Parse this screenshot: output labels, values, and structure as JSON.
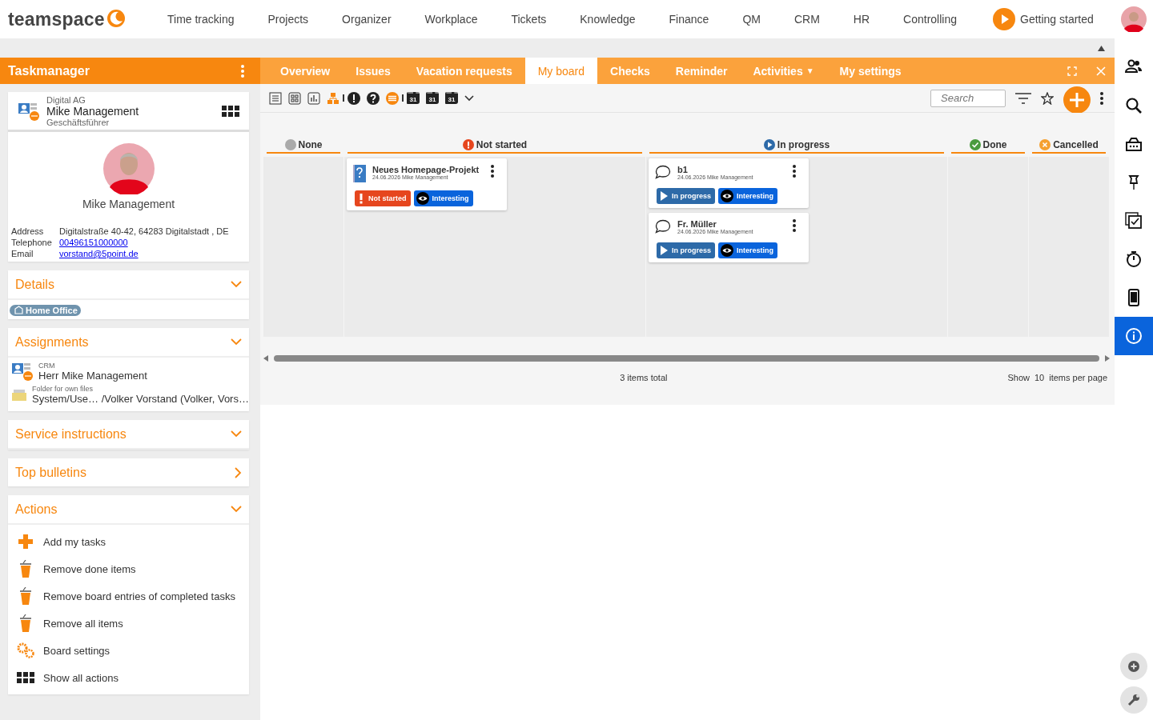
{
  "logo": {
    "text": "teamspace"
  },
  "nav": [
    "Time tracking",
    "Projects",
    "Organizer",
    "Workplace",
    "Tickets",
    "Knowledge",
    "Finance",
    "QM",
    "CRM",
    "HR",
    "Controlling"
  ],
  "getting_started": "Getting started",
  "left_panel": {
    "title": "Taskmanager",
    "contact": {
      "company": "Digital AG",
      "name": "Mike Management",
      "role": "Geschäftsführer",
      "display_name": "Mike Management",
      "fields": [
        {
          "label": "Address",
          "value": "Digitalstraße 40-42, 64283 Digitalstadt , DE",
          "kind": "text"
        },
        {
          "label": "Telephone",
          "value": "00496151000000",
          "kind": "link"
        },
        {
          "label": "Email",
          "value": "vorstand@5point.de",
          "kind": "link"
        }
      ]
    },
    "sections": [
      {
        "title": "Details",
        "expanded": true,
        "tags": [
          "Home Office"
        ]
      },
      {
        "title": "Assignments",
        "expanded": true,
        "items": [
          {
            "kind": "contact",
            "caption": "CRM",
            "value": "Herr Mike Management"
          },
          {
            "kind": "folder",
            "caption": "Folder for own files",
            "value": "System/Use… /Volker Vorstand (Volker, Vors…"
          }
        ]
      },
      {
        "title": "Service instructions",
        "expanded": true
      },
      {
        "title": "Top bulletins",
        "expanded": false
      },
      {
        "title": "Actions",
        "expanded": true,
        "actions": [
          {
            "kind": "add",
            "label": "Add my tasks"
          },
          {
            "kind": "trash",
            "label": "Remove done items"
          },
          {
            "kind": "trash",
            "label": "Remove board entries of completed tasks"
          },
          {
            "kind": "trash",
            "label": "Remove all items"
          },
          {
            "kind": "gears",
            "label": "Board settings"
          },
          {
            "kind": "grid",
            "label": "Show all actions"
          }
        ]
      }
    ]
  },
  "tabs": [
    {
      "label": "Overview",
      "selected": false
    },
    {
      "label": "Issues",
      "selected": false
    },
    {
      "label": "Vacation requests",
      "selected": false
    },
    {
      "label": "My board",
      "selected": true
    },
    {
      "label": "Checks",
      "selected": false
    },
    {
      "label": "Reminder",
      "selected": false
    },
    {
      "label": "Activities",
      "caret": "▼",
      "selected": false
    },
    {
      "label": "My settings",
      "selected": false
    }
  ],
  "toolbar": [
    {
      "kind": "list"
    },
    {
      "kind": "tiles"
    },
    {
      "kind": "chart"
    },
    {
      "kind": "hierarchy"
    },
    {
      "kind": "sep"
    },
    {
      "kind": "alert"
    },
    {
      "kind": "help"
    },
    {
      "kind": "lines"
    },
    {
      "kind": "sep"
    },
    {
      "kind": "calendar",
      "label": "31"
    },
    {
      "kind": "calendar",
      "label": "31"
    },
    {
      "kind": "calendar",
      "label": "31"
    },
    {
      "kind": "chevron"
    }
  ],
  "search": {
    "placeholder": "Search"
  },
  "board": {
    "columns": [
      {
        "name": "None",
        "kind": "none"
      },
      {
        "name": "Not started",
        "kind": "not_started",
        "cards": [
          {
            "kind": "question",
            "title": "Neues Homepage-Projekt",
            "meta": "24.06.2026 Mike Management",
            "tags": [
              {
                "kind": "not_started",
                "label": "Not started"
              },
              {
                "kind": "interesting",
                "label": "Interesting"
              }
            ]
          }
        ]
      },
      {
        "name": "In progress",
        "kind": "in_progress",
        "cards": [
          {
            "kind": "comment",
            "title": "b1",
            "meta": "24.06.2026 Mike Management",
            "tags": [
              {
                "kind": "in_progress",
                "label": "In progress"
              },
              {
                "kind": "interesting",
                "label": "Interesting"
              }
            ]
          },
          {
            "kind": "comment",
            "title": "Fr. Müller",
            "meta": "24.06.2026 Mike Management",
            "tags": [
              {
                "kind": "in_progress",
                "label": "In progress"
              },
              {
                "kind": "interesting",
                "label": "Interesting"
              }
            ]
          }
        ]
      },
      {
        "name": "Done",
        "kind": "done"
      },
      {
        "name": "Cancelled",
        "kind": "cancelled"
      }
    ],
    "total": "3 items total",
    "show": "Show",
    "per_page": "10",
    "per_page_suffix": "items per page"
  },
  "rail": [
    {
      "kind": "people",
      "selected": false
    },
    {
      "kind": "search",
      "selected": false
    },
    {
      "kind": "inbox",
      "selected": false
    },
    {
      "kind": "pin",
      "selected": false
    },
    {
      "kind": "checklist",
      "selected": false
    },
    {
      "kind": "stopwatch",
      "selected": false
    },
    {
      "kind": "phone",
      "selected": false
    },
    {
      "kind": "info",
      "selected": true
    }
  ]
}
